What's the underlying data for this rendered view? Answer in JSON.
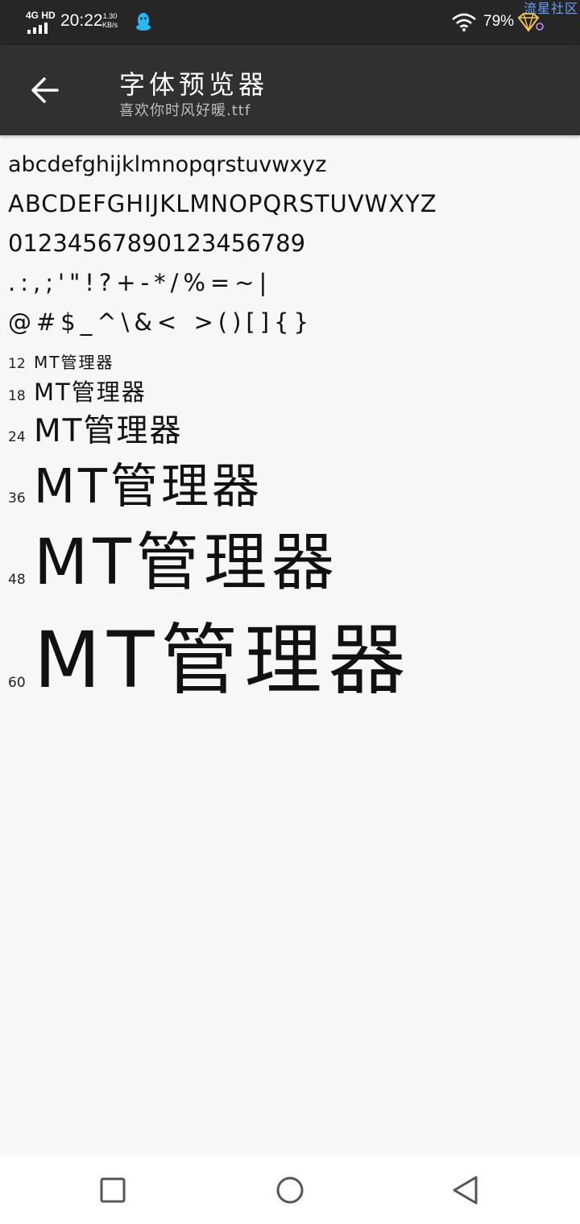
{
  "status_bar": {
    "network": "4G HD",
    "time": "20:22",
    "speed_value": "1.30",
    "speed_unit": "KB/s",
    "battery": "79%",
    "watermark": "流星社区",
    "icons": [
      "signal-icon",
      "qq-icon",
      "wifi-icon",
      "gem-icon"
    ]
  },
  "app_bar": {
    "title": "字体预览器",
    "subtitle": "喜欢你时风好暖.ttf",
    "back_icon": "arrow-left-icon"
  },
  "preview": {
    "lowercase": "abcdefghijklmnopqrstuvwxyz",
    "uppercase": "ABCDEFGHIJKLMNOPQRSTUVWXYZ",
    "digits": "01234567890123456789",
    "punctuation": ".:,;'\"!?+-*/%=~|",
    "symbols": "@#$_^\\&< >()[]{}"
  },
  "size_samples": [
    {
      "size": "12",
      "text": "MT管理器"
    },
    {
      "size": "18",
      "text": "MT管理器"
    },
    {
      "size": "24",
      "text": "MT管理器"
    },
    {
      "size": "36",
      "text": "MT管理器"
    },
    {
      "size": "48",
      "text": "MT管理器"
    },
    {
      "size": "60",
      "text": "MT管理器"
    }
  ],
  "nav_bar": {
    "icons": [
      "recent-apps-icon",
      "home-icon",
      "back-triangle-icon"
    ]
  },
  "colors": {
    "status_bar_bg": "#262626",
    "app_bar_bg": "#303030",
    "content_bg": "#f7f7f7",
    "watermark": "#6aa0ff"
  }
}
